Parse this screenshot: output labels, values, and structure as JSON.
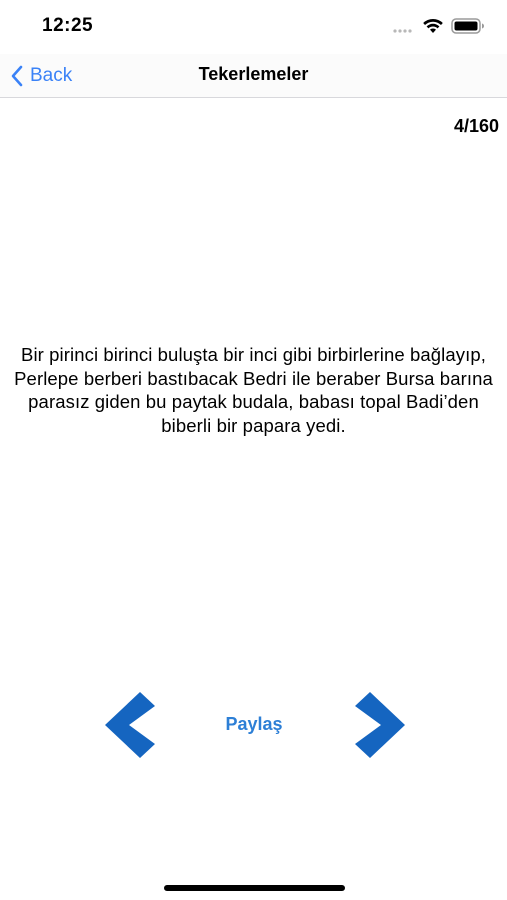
{
  "status_bar": {
    "time": "12:25"
  },
  "nav": {
    "back_label": "Back",
    "title": "Tekerlemeler"
  },
  "counter": "4/160",
  "content": {
    "text": "Bir pirinci birinci buluşta bir inci gibi birbirlerine bağlayıp, Perlepe berberi bastıbacak Bedri ile beraber Bursa barına parasız giden bu paytak budala, babası topal Badi’den biberli bir papara yedi."
  },
  "controls": {
    "share_label": "Paylaş",
    "prev_icon": "chevron-left-icon",
    "next_icon": "chevron-right-icon"
  },
  "colors": {
    "accent": "#3a82f7",
    "arrow": "#1565c0",
    "share": "#2d7fd6"
  }
}
